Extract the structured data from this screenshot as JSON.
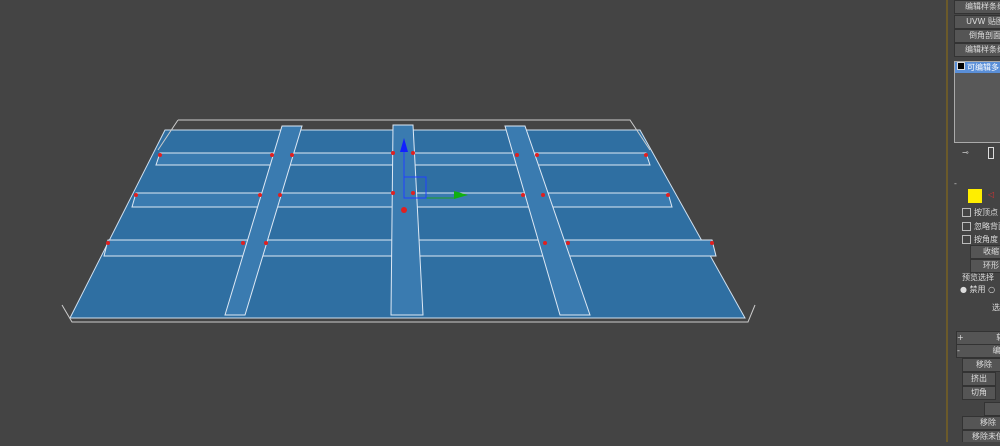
{
  "modifier_stack": {
    "buttons": [
      "编辑样条线",
      "UVW 贴图",
      "倒角剖面",
      "编辑样条线"
    ],
    "list_item": "可编辑多"
  },
  "selection": {
    "rollout_toggle": "-",
    "checkboxes": [
      "按顶点",
      "忽略背面",
      "按角度"
    ],
    "shrink": "收缩",
    "ring": "环形",
    "preview_group": "预览选择",
    "radio_disabled": "禁用",
    "select_text": "选"
  },
  "rollouts": {
    "collapsed": "+",
    "collapsed_label": "软",
    "expanded": "-",
    "expanded_label": "编"
  },
  "edit_buttons": {
    "remove": "移除",
    "extrude": "挤出",
    "chamfer": "切角",
    "remove2": "移除",
    "remove_unused": "移除未使"
  },
  "colors": {
    "plane": "#2f6fa2",
    "background": "#444444",
    "vertex": "#e02020",
    "edge_vertex": "#6060ff"
  }
}
